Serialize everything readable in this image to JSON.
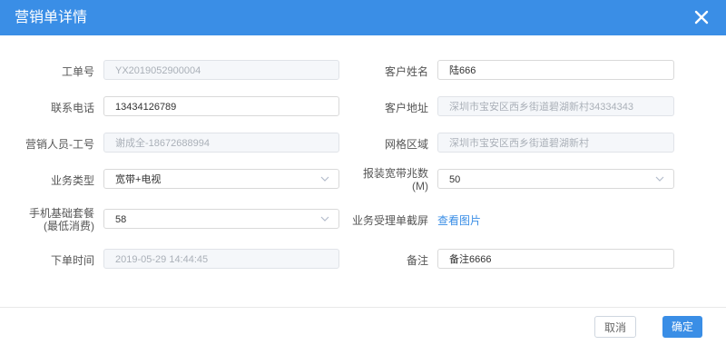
{
  "dialog": {
    "title": "营销单详情"
  },
  "form": {
    "work_order_no": {
      "label": "工单号",
      "value": "YX2019052900004"
    },
    "customer_name": {
      "label": "客户姓名",
      "value": "陆666"
    },
    "phone": {
      "label": "联系电话",
      "value": "13434126789"
    },
    "customer_address": {
      "label": "客户地址",
      "value": "深圳市宝安区西乡街道碧湖新村34334343"
    },
    "marketer": {
      "label": "营销人员-工号",
      "value": "谢成全-18672688994"
    },
    "grid_area": {
      "label": "网格区域",
      "value": "深圳市宝安区西乡街道碧湖新村"
    },
    "business_type": {
      "label": "业务类型",
      "value": "宽带+电视"
    },
    "bandwidth": {
      "label_line1": "报装宽带兆数",
      "label_line2": "(M)",
      "value": "50"
    },
    "mobile_plan": {
      "label_line1": "手机基础套餐",
      "label_line2": "(最低消费)",
      "value": "58"
    },
    "screenshot": {
      "label": "业务受理单截屏",
      "link": "查看图片"
    },
    "order_time": {
      "label": "下单时间",
      "value": "2019-05-29 14:44:45"
    },
    "remark": {
      "label": "备注",
      "value": "备注6666"
    }
  },
  "footer": {
    "cancel_label": "取消",
    "ok_label": "确定"
  },
  "colors": {
    "header": "#3a8ee6",
    "link": "#3a8ee6",
    "disabled_bg": "#f5f7fa"
  },
  "icons": [
    "close-icon",
    "chevron-down-icon"
  ]
}
